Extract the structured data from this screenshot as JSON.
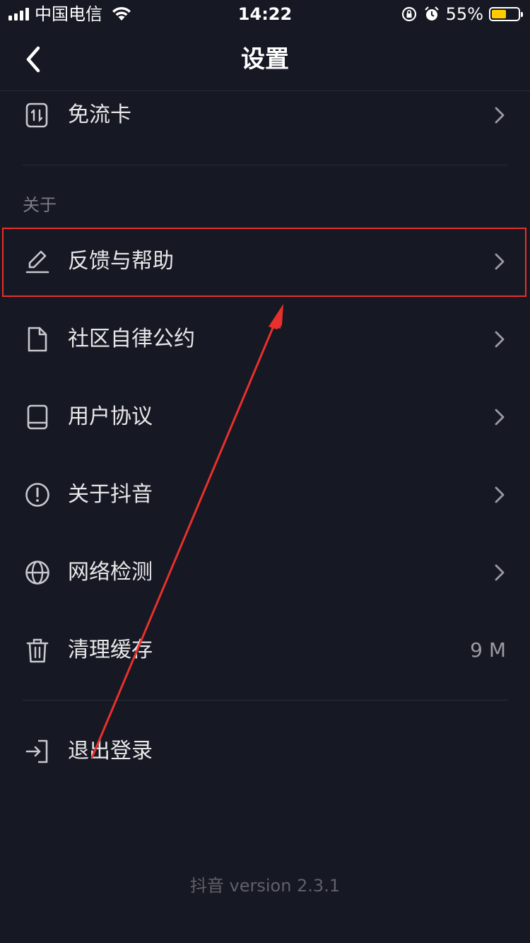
{
  "status_bar": {
    "carrier": "中国电信",
    "time": "14:22",
    "battery_percent": "55%",
    "battery_level": 0.55,
    "battery_color": "#ffcc00"
  },
  "nav": {
    "title": "设置",
    "back_icon": "chevron-left-icon"
  },
  "items_top": [
    {
      "label": "免流卡",
      "icon": "data-card-icon",
      "trailing": "chevron-right-icon"
    }
  ],
  "section_about": {
    "label": "关于",
    "items": [
      {
        "label": "反馈与帮助",
        "icon": "pencil-icon",
        "trailing": "chevron-right-icon"
      },
      {
        "label": "社区自律公约",
        "icon": "document-icon",
        "trailing": "chevron-right-icon"
      },
      {
        "label": "用户协议",
        "icon": "book-icon",
        "trailing": "chevron-right-icon"
      },
      {
        "label": "关于抖音",
        "icon": "info-circle-icon",
        "trailing": "chevron-right-icon"
      },
      {
        "label": "网络检测",
        "icon": "globe-icon",
        "trailing": "chevron-right-icon"
      },
      {
        "label": "清理缓存",
        "icon": "trash-icon",
        "value": "9 M"
      }
    ]
  },
  "logout": {
    "label": "退出登录",
    "icon": "logout-icon"
  },
  "footer": {
    "version": "抖音 version 2.3.1"
  },
  "colors": {
    "background": "#161823",
    "annotation_red": "#e8302c"
  }
}
